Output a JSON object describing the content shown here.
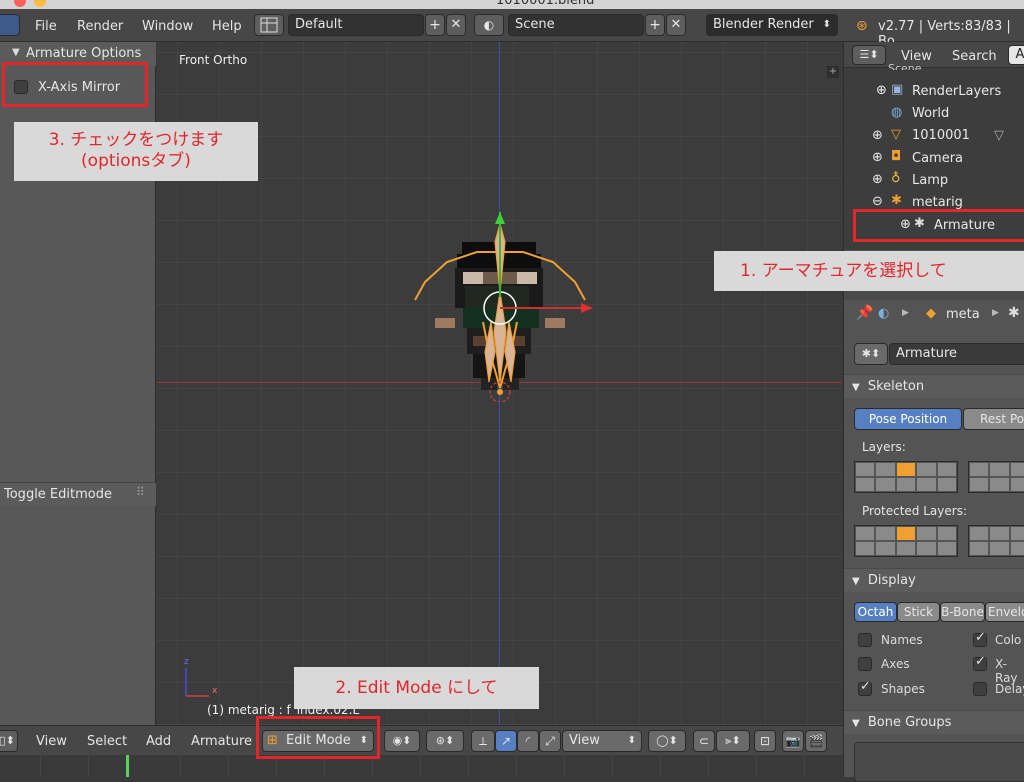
{
  "window": {
    "title": "1010001.blend"
  },
  "info_header": {
    "menus": [
      "File",
      "Render",
      "Window",
      "Help"
    ],
    "screen_layout": "Default",
    "scene": "Scene",
    "render_engine": "Blender Render",
    "stats": "v2.77 | Verts:83/83 | Bo"
  },
  "tool_panel": {
    "section_title": "Armature Options",
    "x_axis_mirror": {
      "label": "X-Axis Mirror",
      "checked": false
    },
    "operator_title": "Toggle Editmode"
  },
  "viewport": {
    "view_label": "Front Ortho",
    "status": "(1) metarig : f_index.02.L",
    "axis_z": "z",
    "axis_x": "x"
  },
  "annotations": {
    "step1": "1. アーマチュアを選択して",
    "step2": "2. Edit Mode にして",
    "step3_line1": "3. チェックをつけます",
    "step3_line2": "(optionsタブ)"
  },
  "bottom_header": {
    "menus": [
      "View",
      "Select",
      "Add",
      "Armature"
    ],
    "mode": "Edit Mode",
    "view_dropdown": "View"
  },
  "outliner": {
    "header": {
      "view": "View",
      "search": "Search",
      "all": "A"
    },
    "items": [
      {
        "label": "Scene"
      },
      {
        "label": "RenderLayers"
      },
      {
        "label": "World"
      },
      {
        "label": "1010001"
      },
      {
        "label": "Camera"
      },
      {
        "label": "Lamp"
      },
      {
        "label": "metarig"
      },
      {
        "label": "Armature"
      }
    ]
  },
  "properties": {
    "breadcrumb": "meta",
    "datablock": "Armature",
    "skeleton": {
      "title": "Skeleton",
      "pose_position": "Pose Position",
      "rest_position": "Rest Po",
      "layers_label": "Layers:",
      "protected_label": "Protected Layers:"
    },
    "display": {
      "title": "Display",
      "modes": [
        "Octah",
        "Stick",
        "B-Bone",
        "Envelo"
      ],
      "options": [
        {
          "label": "Names",
          "checked": false
        },
        {
          "label": "Colo",
          "checked": true
        },
        {
          "label": "Axes",
          "checked": false
        },
        {
          "label": "X-Ray",
          "checked": true
        },
        {
          "label": "Shapes",
          "checked": true
        },
        {
          "label": "Delay",
          "checked": false
        }
      ]
    },
    "bone_groups": {
      "title": "Bone Groups"
    }
  },
  "colors": {
    "highlight": "#e3262a",
    "accent_blue": "#5680c2",
    "bone_orange": "#f0a030"
  }
}
